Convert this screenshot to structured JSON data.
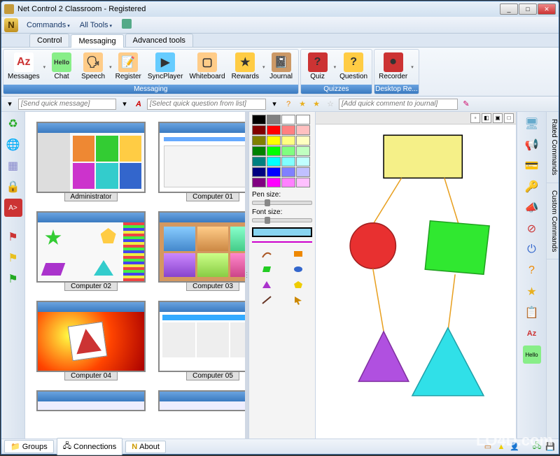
{
  "window": {
    "title": "Net Control 2 Classroom - Registered"
  },
  "menu": {
    "commands": "Commands",
    "all_tools": "All Tools"
  },
  "tabs": {
    "control": "Control",
    "messaging": "Messaging",
    "advanced": "Advanced tools"
  },
  "ribbon": {
    "messaging": {
      "label": "Messaging",
      "items": [
        {
          "label": "Messages",
          "icon": "az-icon"
        },
        {
          "label": "Chat",
          "icon": "hello-icon"
        },
        {
          "label": "Speech",
          "icon": "speech-icon"
        },
        {
          "label": "Register",
          "icon": "register-icon"
        },
        {
          "label": "SyncPlayer",
          "icon": "syncplayer-icon"
        },
        {
          "label": "Whiteboard",
          "icon": "whiteboard-icon"
        },
        {
          "label": "Rewards",
          "icon": "star-icon"
        },
        {
          "label": "Journal",
          "icon": "journal-icon"
        }
      ]
    },
    "quizzes": {
      "label": "Quizzes",
      "items": [
        {
          "label": "Quiz",
          "icon": "quiz-icon"
        },
        {
          "label": "Question",
          "icon": "question-icon"
        }
      ]
    },
    "desktop": {
      "label": "Desktop Re...",
      "items": [
        {
          "label": "Recorder",
          "icon": "recorder-icon"
        }
      ]
    }
  },
  "quickbar": {
    "send_msg_placeholder": "[Send quick message]",
    "select_q_placeholder": "[Select quick question from list]",
    "add_comment_placeholder": "[Add quick comment to journal]"
  },
  "thumbs": [
    {
      "label": "Administrator"
    },
    {
      "label": "Computer 01"
    },
    {
      "label": "Computer 02"
    },
    {
      "label": "Computer 03"
    },
    {
      "label": "Computer 04"
    },
    {
      "label": "Computer 05"
    }
  ],
  "palette": {
    "pen_label": "Pen size:",
    "font_label": "Font size:",
    "colors": [
      "#000000",
      "#808080",
      "#ffffff",
      "#ffffff",
      "#800000",
      "#ff0000",
      "#ff8080",
      "#ffc0c0",
      "#808000",
      "#ffff00",
      "#ffff80",
      "#ffffc0",
      "#008000",
      "#00ff00",
      "#80ff80",
      "#c0ffc0",
      "#008080",
      "#00ffff",
      "#80ffff",
      "#c0ffff",
      "#000080",
      "#0000ff",
      "#8080ff",
      "#c0c0ff",
      "#800080",
      "#ff00ff",
      "#ff80ff",
      "#ffc0ff"
    ]
  },
  "status_tabs": {
    "groups": "Groups",
    "connections": "Connections",
    "about": "About"
  },
  "vtabs": {
    "rated": "Rated Commands",
    "custom": "Custom Commands"
  },
  "watermark": "LO4D.com"
}
